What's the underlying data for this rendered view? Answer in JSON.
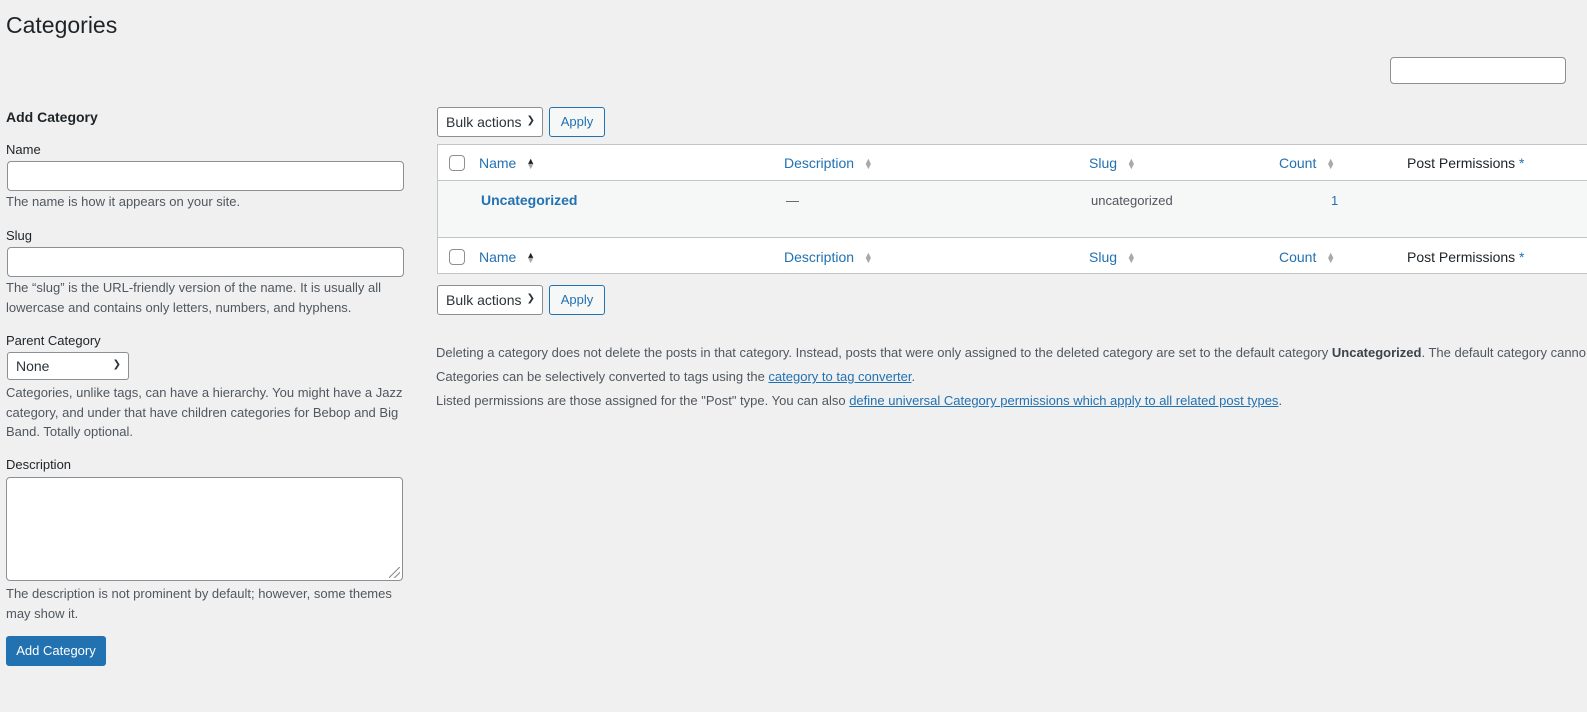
{
  "page": {
    "title": "Categories"
  },
  "search": {
    "placeholder": ""
  },
  "form": {
    "heading": "Add Category",
    "name_label": "Name",
    "name_help": "The name is how it appears on your site.",
    "slug_label": "Slug",
    "slug_help_1": "The “slug” is the URL-friendly version of the name. It is usually all",
    "slug_help_2": "lowercase and contains only letters, numbers, and hyphens.",
    "parent_label": "Parent Category",
    "parent_value": "None",
    "parent_help_1": "Categories, unlike tags, can have a hierarchy. You might have a Jazz",
    "parent_help_2": "category, and under that have children categories for Bebop and Big",
    "parent_help_3": "Band. Totally optional.",
    "description_label": "Description",
    "description_help_1": "The description is not prominent by default; however, some themes",
    "description_help_2": "may show it.",
    "submit_label": "Add Category"
  },
  "bulk": {
    "label": "Bulk actions",
    "apply_label": "Apply"
  },
  "table": {
    "columns": {
      "name": "Name",
      "description": "Description",
      "slug": "Slug",
      "count": "Count",
      "permissions": "Post Permissions",
      "permissions_mark": "*"
    },
    "rows": [
      {
        "name": "Uncategorized",
        "description": "—",
        "slug": "uncategorized",
        "count": "1"
      }
    ]
  },
  "notes": {
    "line1_pre": "Deleting a category does not delete the posts in that category. Instead, posts that were only assigned to the deleted category are set to the default category ",
    "line1_bold": "Uncategorized",
    "line1_post": ". The default category canno",
    "line2_pre": "Categories can be selectively converted to tags using the ",
    "line2_link": "category to tag converter",
    "line2_post": ".",
    "line3_pre": "Listed permissions are those assigned for the \"Post\" type. You can also ",
    "line3_link": "define universal Category permissions which apply to all related post types",
    "line3_post": "."
  },
  "icons": {
    "select_chevron": "chevron-down-icon",
    "sort_indicator": "sort-arrows-icon",
    "resize_grip": "resize-grip-icon"
  },
  "colors": {
    "accent": "#2271b1",
    "background": "#f0f0f1",
    "text": "#1d2327",
    "muted": "#50575e"
  }
}
